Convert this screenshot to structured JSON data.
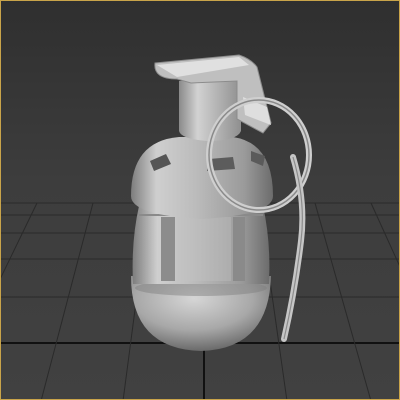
{
  "viewport": {
    "active_border_color": "#c9a44a",
    "background_color": "#3c3c3c",
    "grid_color": "#1e1e1e",
    "model_color": "#bdbdbd",
    "model_object": "frag-grenade-model"
  }
}
